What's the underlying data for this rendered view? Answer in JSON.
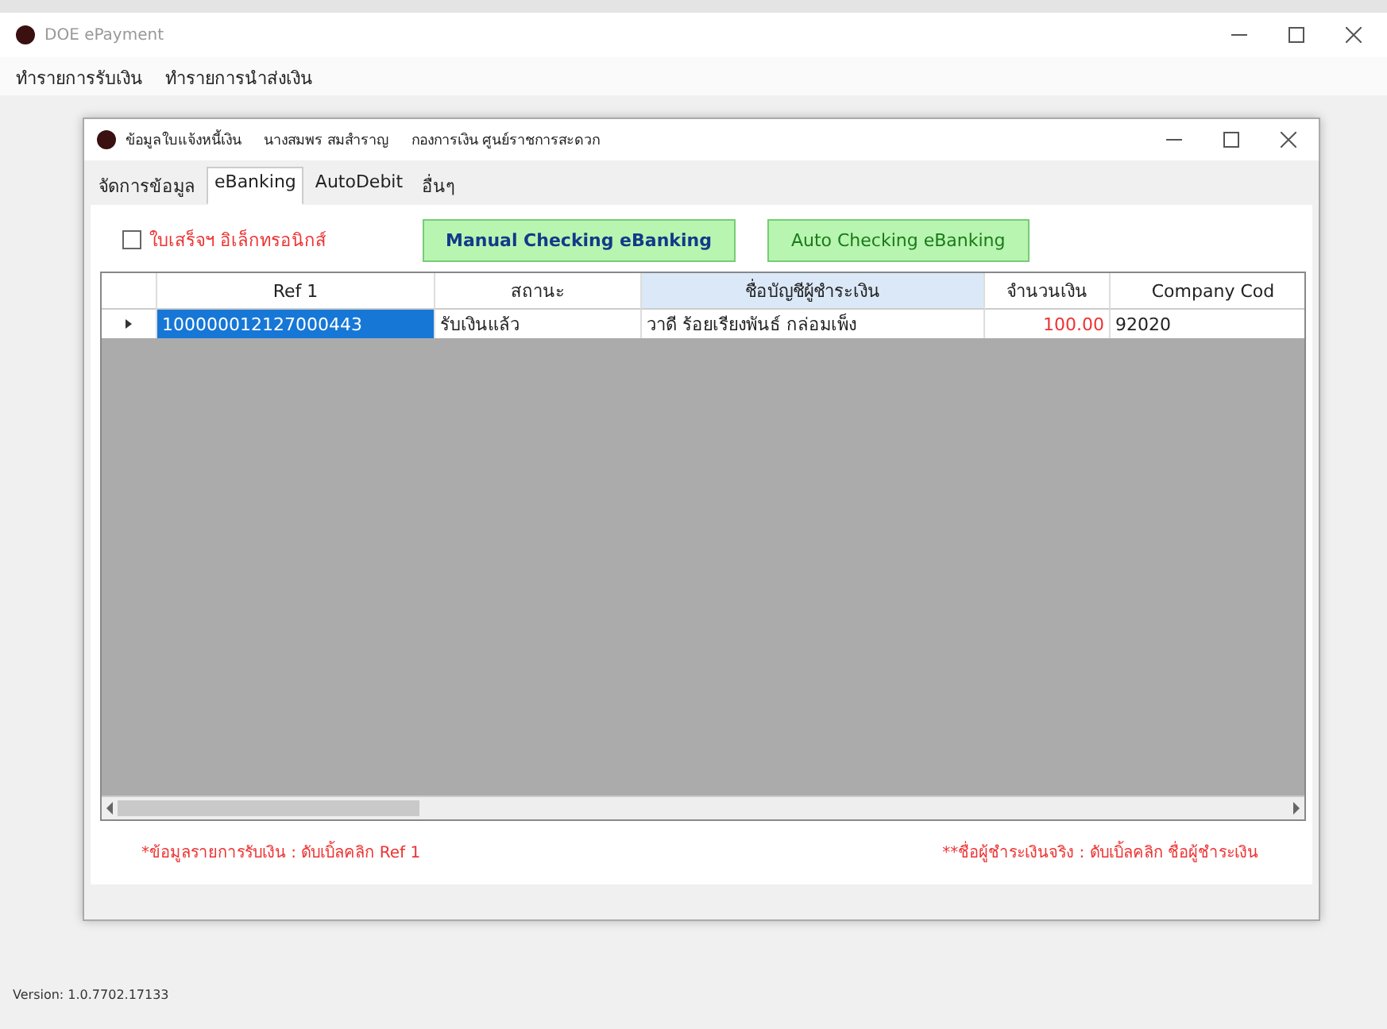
{
  "window": {
    "title": "DOE ePayment"
  },
  "menu": [
    "ทำรายการรับเงิน",
    "ทำรายการนำส่งเงิน"
  ],
  "dialog": {
    "title_parts": [
      "ข้อมูลใบแจ้งหนี้เงิน",
      "นางสมพร สมสำราญ",
      "กองการเงิน ศูนย์ราชการสะดวก"
    ],
    "tabs": [
      {
        "label": "จัดการข้อมูล",
        "selected": false
      },
      {
        "label": "eBanking",
        "selected": true
      },
      {
        "label": "AutoDebit",
        "selected": false
      },
      {
        "label": "อื่นๆ",
        "selected": false
      }
    ],
    "checkbox": {
      "label": "ใบเสร็จฯ อิเล็กทรอนิกส์",
      "checked": false
    },
    "buttons": [
      {
        "label": "Manual Checking eBanking",
        "kind": "manual"
      },
      {
        "label": "Auto Checking eBanking",
        "kind": "auto"
      }
    ],
    "table": {
      "columns": [
        {
          "label": "Ref 1",
          "highlighted": false
        },
        {
          "label": "สถานะ",
          "highlighted": false
        },
        {
          "label": "ชื่อบัญชีผู้ชำระเงิน",
          "highlighted": true
        },
        {
          "label": "จำนวนเงิน",
          "highlighted": false
        },
        {
          "label": "Company Cod",
          "highlighted": false
        }
      ],
      "rows": [
        {
          "current": true,
          "cells": [
            "100000012127000443",
            "รับเงินแล้ว",
            "วาดี ร้อยเรียงพันธ์ กล่อมเพ็ง",
            "100.00",
            "92020"
          ]
        }
      ]
    },
    "notes": [
      "*ข้อมูลรายการรับเงิน : ดับเบิ้ลคลิก Ref 1",
      "**ชื่อผู้ชำระเงินจริง : ดับเบิ้ลคลิก ชื่อผู้ชำระเงิน"
    ]
  },
  "status_bar": {
    "version": "Version: 1.0.7702.17133"
  }
}
